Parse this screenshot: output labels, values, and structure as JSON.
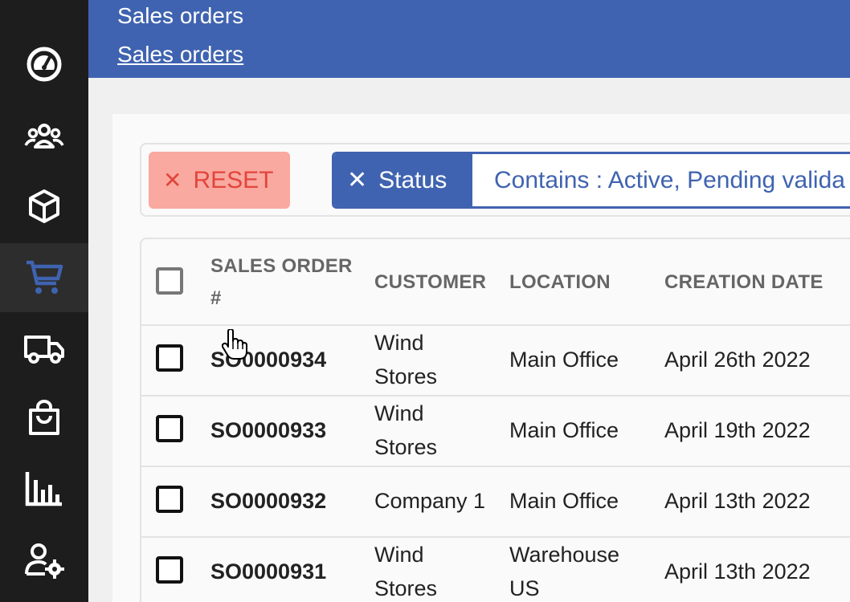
{
  "header": {
    "title": "Sales orders",
    "breadcrumb": "Sales orders"
  },
  "sidebar": {
    "items": [
      {
        "icon": "dashboard-icon"
      },
      {
        "icon": "users-icon"
      },
      {
        "icon": "product-box-icon"
      },
      {
        "icon": "cart-icon",
        "active": true
      },
      {
        "icon": "truck-icon"
      },
      {
        "icon": "shopping-bag-icon"
      },
      {
        "icon": "bar-chart-icon"
      },
      {
        "icon": "user-settings-icon"
      }
    ]
  },
  "filters": {
    "reset_label": "RESET",
    "chip_field": "Status",
    "chip_value": "Contains : Active, Pending valida"
  },
  "table": {
    "headers": [
      "SALES ORDER",
      "#",
      "CUSTOMER",
      "LOCATION",
      "CREATION DATE"
    ],
    "rows": [
      {
        "order": "SO0000934",
        "customer_l1": "Wind",
        "customer_l2": "Stores",
        "location_l1": "Main Office",
        "location_l2": "",
        "date": "April 26th 2022"
      },
      {
        "order": "SO0000933",
        "customer_l1": "Wind",
        "customer_l2": "Stores",
        "location_l1": "Main Office",
        "location_l2": "",
        "date": "April 19th 2022"
      },
      {
        "order": "SO0000932",
        "customer_l1": "Company 1",
        "customer_l2": "",
        "location_l1": "Main Office",
        "location_l2": "",
        "date": "April 13th 2022"
      },
      {
        "order": "SO0000931",
        "customer_l1": "Wind",
        "customer_l2": "Stores",
        "location_l1": "Warehouse",
        "location_l2": "US",
        "date": "April 13th 2022"
      }
    ]
  },
  "colors": {
    "brand": "#3f63b0",
    "sidebar": "#1d1d1d",
    "reset_bg": "#f9a9a0",
    "reset_text": "#e2453c"
  }
}
